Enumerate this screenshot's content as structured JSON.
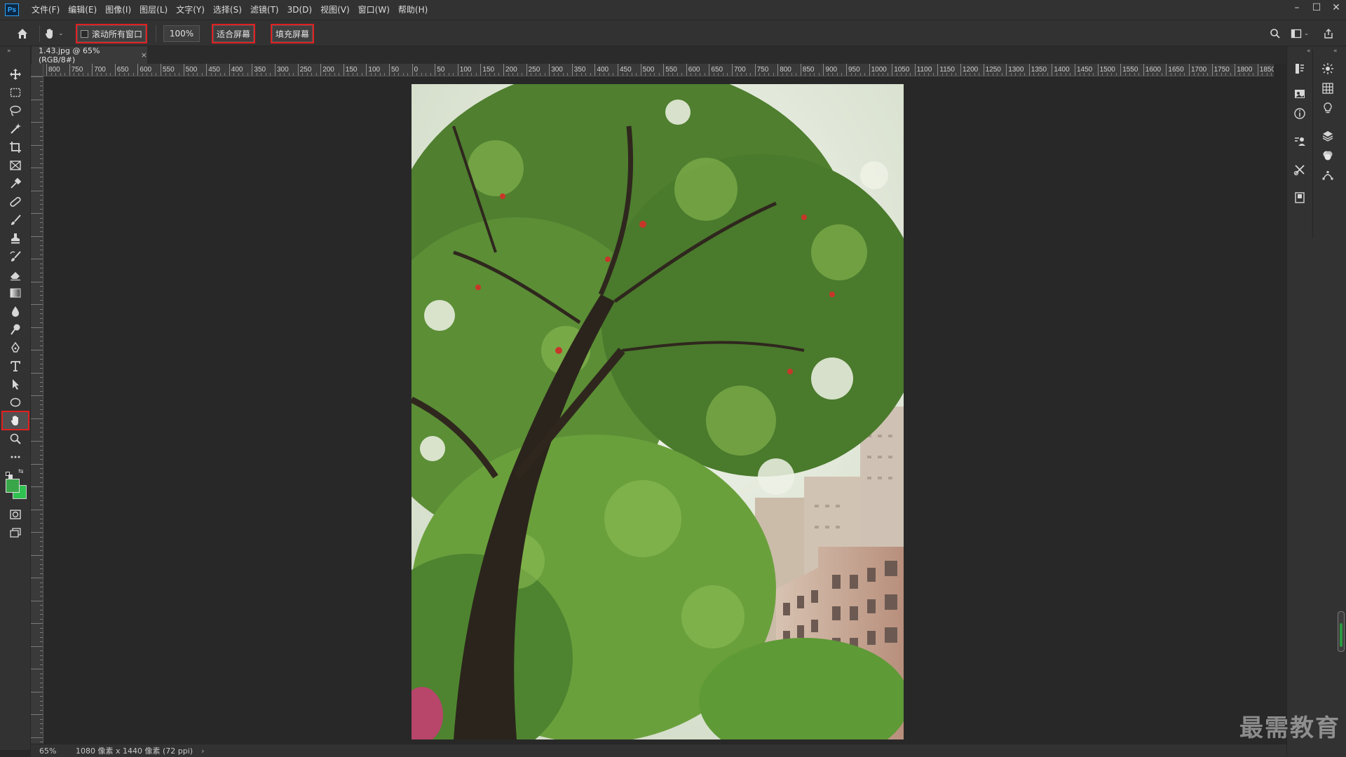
{
  "app": {
    "logo": "Ps",
    "colors": {
      "accent": "#31a8ff",
      "highlight": "#e02020",
      "foreground": "#3aa64a",
      "background_color": "#2fc251"
    }
  },
  "menu": {
    "items": [
      "文件(F)",
      "编辑(E)",
      "图像(I)",
      "图层(L)",
      "文字(Y)",
      "选择(S)",
      "滤镜(T)",
      "3D(D)",
      "视图(V)",
      "窗口(W)",
      "帮助(H)"
    ]
  },
  "window_controls": {
    "minimize": "–",
    "restore": "☐",
    "close": "✕"
  },
  "options": {
    "scroll_all_label": "滚动所有窗口",
    "zoom_value": "100%",
    "fit_screen_label": "适合屏幕",
    "fill_screen_label": "填充屏幕"
  },
  "document": {
    "tab_label": "1.43.jpg @ 65%(RGB/8#)",
    "close_glyph": "×"
  },
  "ruler": {
    "labels": [
      "800",
      "750",
      "700",
      "650",
      "600",
      "550",
      "500",
      "450",
      "400",
      "350",
      "300",
      "250",
      "200",
      "150",
      "100",
      "50",
      "0",
      "50",
      "100",
      "150",
      "200",
      "250",
      "300",
      "350",
      "400",
      "450",
      "500",
      "550",
      "600",
      "650",
      "700",
      "750",
      "800",
      "850",
      "900",
      "950",
      "1000",
      "1050",
      "1100",
      "1150",
      "1200",
      "1250",
      "1300",
      "1350",
      "1400",
      "1450",
      "1500",
      "1550",
      "1600",
      "1650",
      "1700",
      "1750",
      "1800",
      "1850"
    ]
  },
  "status": {
    "zoom": "65%",
    "size_info": "1080 像素 x 1440 像素 (72 ppi)",
    "arrow": "›"
  },
  "watermark": "最需教育"
}
